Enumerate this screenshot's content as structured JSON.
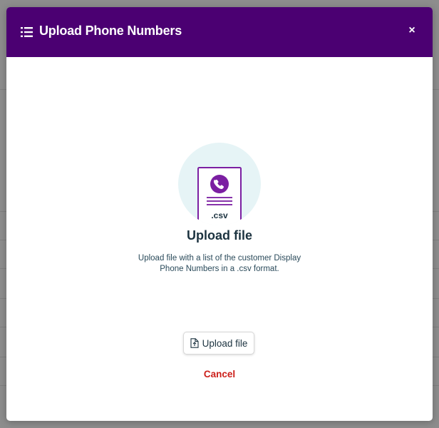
{
  "modal": {
    "title": "Upload Phone Numbers",
    "close_label": "×",
    "header_color": "#4b0072"
  },
  "body": {
    "illustration_label": ".csv",
    "heading": "Upload file",
    "description": "Upload file with a list of the customer Display Phone Numbers in a .csv format.",
    "upload_button_label": "Upload file",
    "cancel_label": "Cancel"
  },
  "icons": {
    "header": "list-icon",
    "illustration": "csv-phone-file-icon",
    "upload": "file-upload-icon"
  },
  "colors": {
    "accent": "#4b0072",
    "file_purple": "#7b1fa2",
    "illustration_bg": "#e6f4f6",
    "cancel": "#cc1f1a"
  }
}
